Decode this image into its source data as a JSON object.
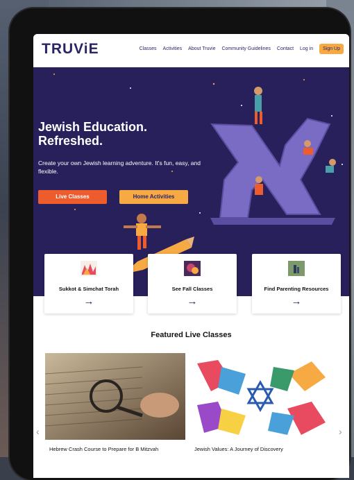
{
  "nav": {
    "logo": "TRUViE",
    "links": [
      "Classes",
      "Activities",
      "About Truvie",
      "Community Guidelines",
      "Contact",
      "Log in"
    ],
    "signup": "Sign Up"
  },
  "hero": {
    "title_line1": "Jewish Education.",
    "title_line2": "Refreshed.",
    "subtitle": "Create your own Jewish learning adventure. It's fun, easy, and flexible.",
    "btn_live": "Live Classes",
    "btn_home": "Home Activities"
  },
  "cards": [
    {
      "label": "Sukkot & Simchat Torah",
      "arrow": "→"
    },
    {
      "label": "See Fall Classes",
      "arrow": "→"
    },
    {
      "label": "Find Parenting Resources",
      "arrow": "→"
    }
  ],
  "featured": {
    "heading": "Featured Live Classes",
    "classes": [
      {
        "title": "Hebrew Crash Course to Prepare for B Mitzvah"
      },
      {
        "title": "Jewish Values: A Journey of Discovery"
      }
    ],
    "prev": "‹",
    "next": "›"
  },
  "colors": {
    "primary": "#2a2466",
    "hero_bg": "#27205a",
    "orange": "#ee5c2e",
    "yellow": "#f7a944"
  },
  "icons": {
    "arrow": "arrow-right-icon",
    "prev": "chevron-left-icon",
    "next": "chevron-right-icon"
  }
}
